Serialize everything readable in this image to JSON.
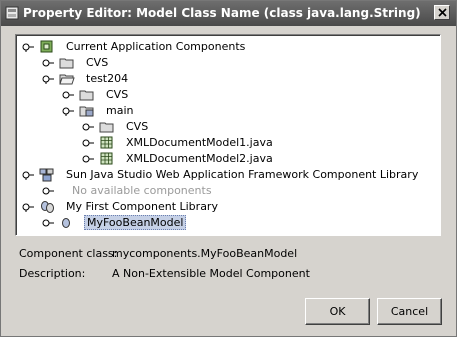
{
  "window": {
    "title": "Property Editor: Model Class Name (class java.lang.String)"
  },
  "tree": {
    "nodes": [
      {
        "label": "Current Application Components",
        "icon": "project-icon"
      },
      {
        "label": "CVS",
        "icon": "folder-icon"
      },
      {
        "label": "test204",
        "icon": "open-folder-icon"
      },
      {
        "label": "CVS",
        "icon": "folder-icon"
      },
      {
        "label": "main",
        "icon": "package-icon"
      },
      {
        "label": "CVS",
        "icon": "folder-icon"
      },
      {
        "label": "XMLDocumentModel1.java",
        "icon": "java-class-icon"
      },
      {
        "label": "XMLDocumentModel2.java",
        "icon": "java-class-icon"
      },
      {
        "label": "Sun Java Studio Web Application Framework Component Library",
        "icon": "library-icon"
      },
      {
        "label": "No available components",
        "icon": ""
      },
      {
        "label": "My First Component Library",
        "icon": "library-beans-icon"
      },
      {
        "label": "MyFooBeanModel",
        "icon": "bean-icon"
      }
    ]
  },
  "info": {
    "component_class_label": "Component class:",
    "component_class_value": "mycomponents.MyFooBeanModel",
    "description_label": "Description:",
    "description_value": "A Non-Extensible Model Component"
  },
  "buttons": {
    "ok": "OK",
    "cancel": "Cancel"
  }
}
